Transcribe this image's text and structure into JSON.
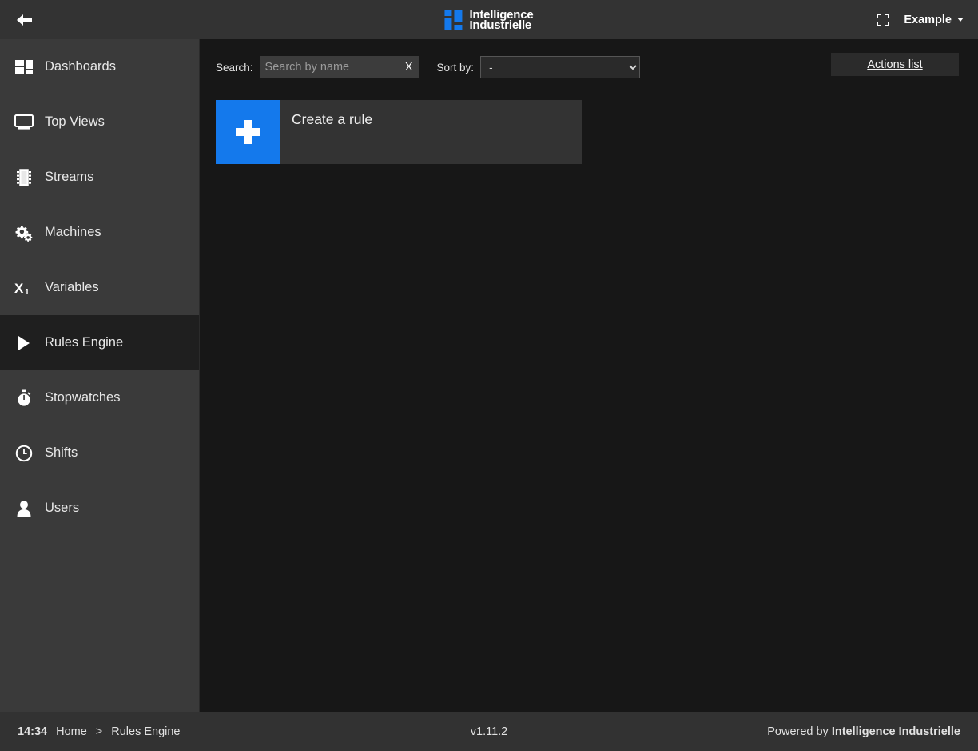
{
  "header": {
    "back_icon": "arrow-left-icon",
    "brand": {
      "line1": "Intelligence",
      "line2": "Industrielle",
      "mark_color": "#1479ec"
    },
    "fullscreen_icon": "fullscreen-icon",
    "account_label": "Example"
  },
  "sidebar": {
    "items": [
      {
        "label": "Dashboards",
        "icon": "dashboard-grid-icon",
        "active": false
      },
      {
        "label": "Top Views",
        "icon": "monitor-icon",
        "active": false
      },
      {
        "label": "Streams",
        "icon": "chip-icon",
        "active": false
      },
      {
        "label": "Machines",
        "icon": "gears-icon",
        "active": false
      },
      {
        "label": "Variables",
        "icon": "variable-x1-icon",
        "active": false
      },
      {
        "label": "Rules Engine",
        "icon": "play-triangle-icon",
        "active": true
      },
      {
        "label": "Stopwatches",
        "icon": "stopwatch-icon",
        "active": false
      },
      {
        "label": "Shifts",
        "icon": "clock-icon",
        "active": false
      },
      {
        "label": "Users",
        "icon": "user-icon",
        "active": false
      }
    ]
  },
  "toolbar": {
    "search_label": "Search:",
    "search_value": "",
    "search_placeholder": "Search by name",
    "clear_label": "X",
    "sort_label": "Sort by:",
    "sort_selected": "-",
    "sort_options": [
      "-"
    ],
    "actions_button": "Actions list"
  },
  "main": {
    "create_card": {
      "title": "Create a rule",
      "icon": "plus-icon",
      "accent_color": "#1479ec"
    }
  },
  "footer": {
    "clock": "14:34",
    "breadcrumb_home": "Home",
    "breadcrumb_separator": ">",
    "breadcrumb_current": "Rules Engine",
    "version": "v1.11.2",
    "powered_prefix": "Powered by ",
    "powered_brand": "Intelligence Industrielle"
  }
}
